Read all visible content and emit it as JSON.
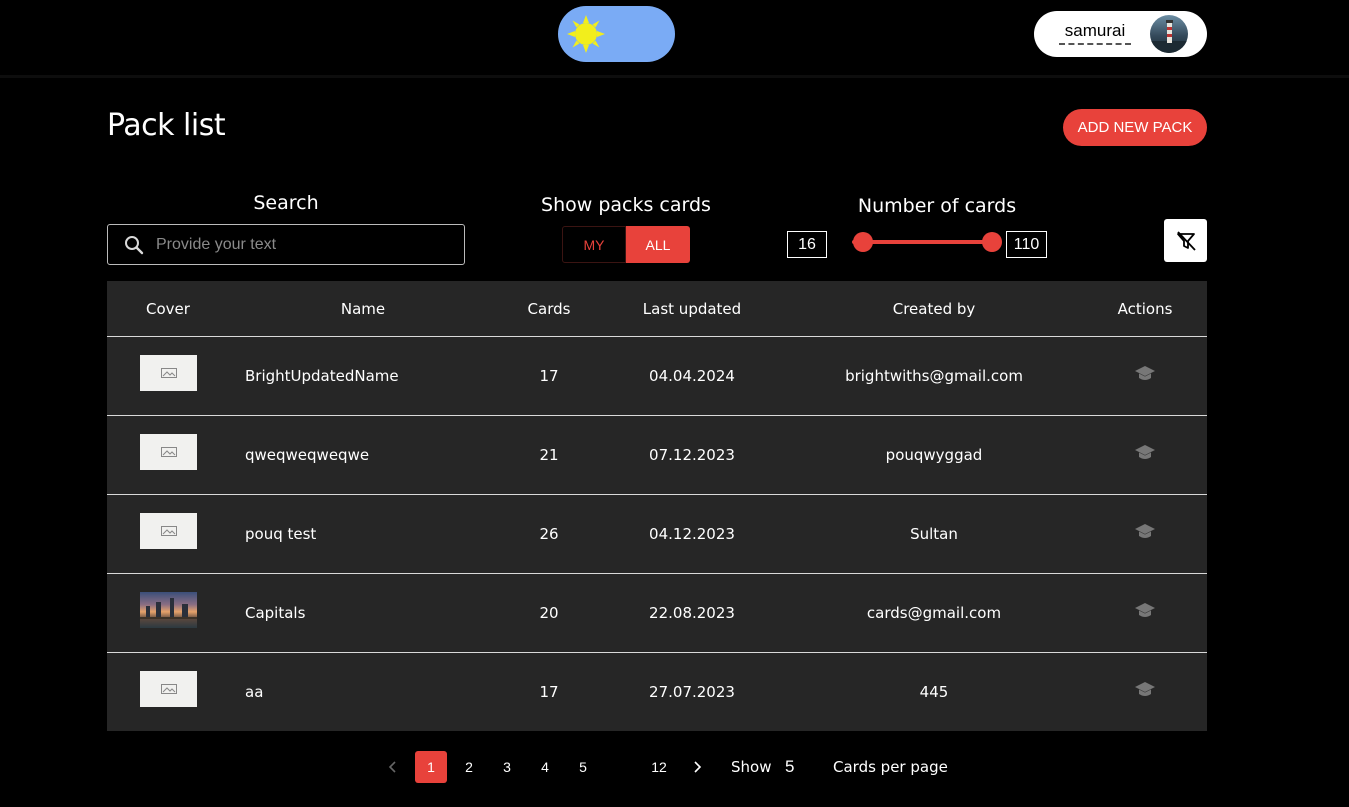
{
  "header": {
    "user_name": "samurai"
  },
  "page": {
    "title": "Pack list",
    "add_button": "ADD NEW PACK"
  },
  "filters": {
    "search_label": "Search",
    "search_placeholder": "Provide your text",
    "show_label": "Show packs cards",
    "toggle_my": "MY",
    "toggle_all": "ALL",
    "toggle_selected": "ALL",
    "range_label": "Number of cards",
    "range_min": "16",
    "range_max": "110"
  },
  "table": {
    "headers": [
      "Cover",
      "Name",
      "Cards",
      "Last updated",
      "Created by",
      "Actions"
    ],
    "rows": [
      {
        "name": "BrightUpdatedName",
        "cards": "17",
        "updated": "04.04.2024",
        "created_by": "brightwiths@gmail.com",
        "cover": "placeholder-image"
      },
      {
        "name": "qweqweqweqwe",
        "cards": "21",
        "updated": "07.12.2023",
        "created_by": "pouqwyggad",
        "cover": "placeholder-image"
      },
      {
        "name": "pouq test",
        "cards": "26",
        "updated": "04.12.2023",
        "created_by": "Sultan",
        "cover": "placeholder-image"
      },
      {
        "name": "Capitals",
        "cards": "20",
        "updated": "22.08.2023",
        "created_by": "cards@gmail.com",
        "cover": "city-photo"
      },
      {
        "name": "aa",
        "cards": "17",
        "updated": "27.07.2023",
        "created_by": "445",
        "cover": "placeholder-image"
      }
    ]
  },
  "pagination": {
    "pages": [
      "1",
      "2",
      "3",
      "4",
      "5",
      "12"
    ],
    "current": "1",
    "show_label": "Show",
    "show_value": "5",
    "per_page_label": "Cards per page"
  },
  "colors": {
    "accent": "#e8423b",
    "table_bg": "#262626",
    "toggle_bg": "#7aabf5",
    "sun": "#f2ee1c"
  },
  "icons": [
    "sun-icon",
    "avatar",
    "search-icon",
    "filter-off-icon",
    "learn-icon",
    "chevron-left-icon",
    "chevron-right-icon"
  ]
}
